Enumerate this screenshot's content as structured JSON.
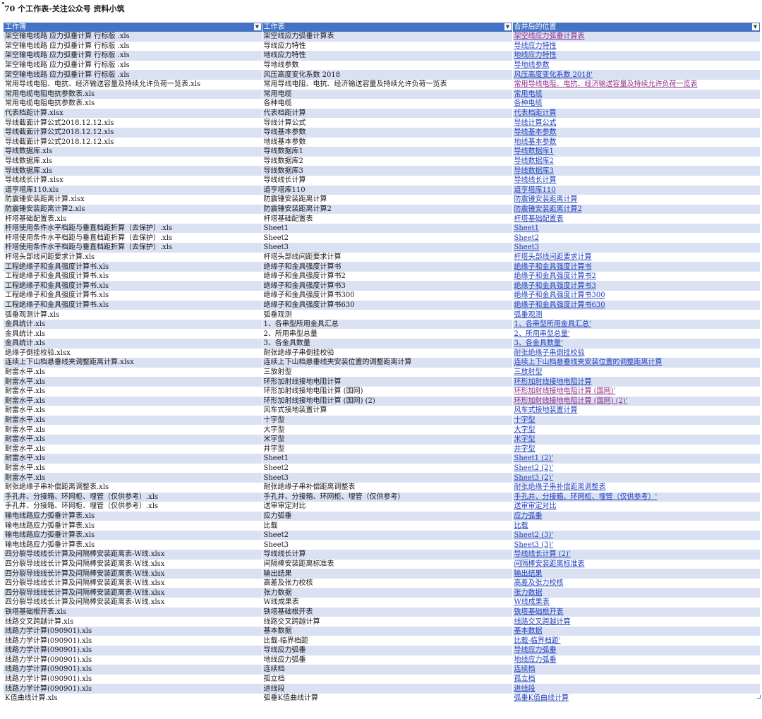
{
  "title": "70 个工作表-关注公众号 资料小筑",
  "headers": [
    "工作簿",
    "工作表",
    "合并后的位置"
  ],
  "filter_icon": "dropdown-arrow-icon",
  "colors": {
    "header": "#4472c4",
    "band": "#d9e1f2",
    "link": "#1f3fbf",
    "visited_link": "#8e2f8a"
  },
  "rows": [
    {
      "workbook": "架空输电线路 应力弧垂计算 行标版 .xls",
      "sheet": "架空线应力弧垂计算表",
      "link": "架空线应力弧垂计算表",
      "visited": true
    },
    {
      "workbook": "架空输电线路 应力弧垂计算 行标版 .xls",
      "sheet": "导线应力特性",
      "link": "导线应力特性",
      "visited": false
    },
    {
      "workbook": "架空输电线路 应力弧垂计算 行标版 .xls",
      "sheet": "地线应力特性",
      "link": "地线应力特性",
      "visited": false
    },
    {
      "workbook": "架空输电线路 应力弧垂计算 行标版 .xls",
      "sheet": "导地线参数",
      "link": "导地线参数",
      "visited": false
    },
    {
      "workbook": "架空输电线路 应力弧垂计算 行标版 .xls",
      "sheet": "风压高度变化系数 2018",
      "link": "风压高度变化系数 2018'",
      "visited": false
    },
    {
      "workbook": "常用导线电阻、电抗、经济输送容量及持续允许负荷一览表.xls",
      "sheet": "常用导线电阻、电抗、经济输送容量及持续允许负荷一览表",
      "link": "常用导线电阻、电抗、经济输送容量及持续允许负荷一览表",
      "visited": true
    },
    {
      "workbook": "常用电缆电阻电抗参数表.xls",
      "sheet": "常用电缆",
      "link": "常用电缆",
      "visited": false
    },
    {
      "workbook": "常用电缆电阻电抗参数表.xls",
      "sheet": "各种电缆",
      "link": "各种电缆",
      "visited": false
    },
    {
      "workbook": "代表档距计算.xlsx",
      "sheet": "代表档距计算",
      "link": "代表档距计算",
      "visited": false
    },
    {
      "workbook": "导线截面计算公式2018.12.12.xls",
      "sheet": "导线计算公式",
      "link": "导线计算公式",
      "visited": false
    },
    {
      "workbook": "导线截面计算公式2018.12.12.xls",
      "sheet": "导线基本参数",
      "link": "导线基本参数",
      "visited": false
    },
    {
      "workbook": "导线截面计算公式2018.12.12.xls",
      "sheet": "地线基本参数",
      "link": "地线基本参数",
      "visited": false
    },
    {
      "workbook": "导线数据库.xls",
      "sheet": "导线数据库1",
      "link": "导线数据库1",
      "visited": false
    },
    {
      "workbook": "导线数据库.xls",
      "sheet": "导线数据库2",
      "link": "导线数据库2",
      "visited": false
    },
    {
      "workbook": "导线数据库.xls",
      "sheet": "导线数据库3",
      "link": "导线数据库3",
      "visited": false
    },
    {
      "workbook": "导线线长计算.xlsx",
      "sheet": "导线线长计算",
      "link": "导线线长计算",
      "visited": false
    },
    {
      "workbook": "道亨塔库110.xls",
      "sheet": "道亨塔库110",
      "link": "道亨塔库110",
      "visited": false
    },
    {
      "workbook": "防震锤安装距离计算.xlsx",
      "sheet": "防震锤安装距离计算",
      "link": "防震锤安装距离计算",
      "visited": false
    },
    {
      "workbook": "防震锤安装距离计算2.xls",
      "sheet": "防震锤安装距离计算2",
      "link": "防震锤安装距离计算2",
      "visited": false
    },
    {
      "workbook": "杆塔基础配置表.xls",
      "sheet": "杆塔基础配置表",
      "link": "杆塔基础配置表",
      "visited": false
    },
    {
      "workbook": "杆塔使用条件水平档距与垂直档距折算（去保护）.xls",
      "sheet": "Sheet1",
      "link": "Sheet1",
      "visited": false
    },
    {
      "workbook": "杆塔使用条件水平档距与垂直档距折算（去保护）.xls",
      "sheet": "Sheet2",
      "link": "Sheet2",
      "visited": false
    },
    {
      "workbook": "杆塔使用条件水平档距与垂直档距折算（去保护）.xls",
      "sheet": "Sheet3",
      "link": "Sheet3",
      "visited": false
    },
    {
      "workbook": "杆塔头部线间距要求计算.xls",
      "sheet": "杆塔头部线间距要求计算",
      "link": "杆塔头部线间距要求计算",
      "visited": false
    },
    {
      "workbook": "工程绝缘子和金具强度计算书.xls",
      "sheet": "绝缘子和金具强度计算书",
      "link": "绝缘子和金具强度计算书",
      "visited": false
    },
    {
      "workbook": "工程绝缘子和金具强度计算书.xls",
      "sheet": "绝缘子和金具强度计算书2",
      "link": "绝缘子和金具强度计算书2",
      "visited": false
    },
    {
      "workbook": "工程绝缘子和金具强度计算书.xls",
      "sheet": "绝缘子和金具强度计算书3",
      "link": "绝缘子和金具强度计算书3",
      "visited": false
    },
    {
      "workbook": "工程绝缘子和金具强度计算书.xls",
      "sheet": "绝缘子和金具强度计算书300",
      "link": "绝缘子和金具强度计算书300",
      "visited": false
    },
    {
      "workbook": "工程绝缘子和金具强度计算书.xls",
      "sheet": "绝缘子和金具强度计算书630",
      "link": "绝缘子和金具强度计算书630",
      "visited": false
    },
    {
      "workbook": "弧垂观测计算.xls",
      "sheet": "弧垂观测",
      "link": "弧垂观测",
      "visited": false
    },
    {
      "workbook": "金具统计.xls",
      "sheet": "1、各串型所用金具汇总",
      "link": "1、各串型所用金具汇总'",
      "visited": false
    },
    {
      "workbook": "金具统计.xls",
      "sheet": "2、所用串型总量",
      "link": "2、所用串型总量'",
      "visited": false
    },
    {
      "workbook": "金具统计.xls",
      "sheet": "3、各金具数量",
      "link": "3、各金具数量'",
      "visited": false
    },
    {
      "workbook": "绝缘子倒挂校验.xlsx",
      "sheet": "耐张绝缘子串倒挂校验",
      "link": "耐张绝缘子串倒挂校验",
      "visited": false
    },
    {
      "workbook": "连续上下山档悬垂线夹调整距离计算.xlsx",
      "sheet": "连续上下山档悬垂线夹安装位置的调整距离计算",
      "link": "连续上下山档悬垂线夹安装位置的调整距离计算",
      "visited": false
    },
    {
      "workbook": "耐雷水平.xls",
      "sheet": "三放射型",
      "link": "三放射型",
      "visited": false
    },
    {
      "workbook": "耐雷水平.xls",
      "sheet": "环形加射线接地电阻计算",
      "link": "环形加射线接地电阻计算",
      "visited": false
    },
    {
      "workbook": "耐雷水平.xls",
      "sheet": "环形加射线接地电阻计算 (国网)",
      "link": "环形加射线接地电阻计算 (国网)'",
      "visited": true
    },
    {
      "workbook": "耐雷水平.xls",
      "sheet": "环形加射线接地电阻计算 (国网) (2)",
      "link": "环形加射线接地电阻计算 (国网) (2)'",
      "visited": true
    },
    {
      "workbook": "耐雷水平.xls",
      "sheet": "风车式接地装置计算",
      "link": "风车式接地装置计算",
      "visited": false
    },
    {
      "workbook": "耐雷水平.xls",
      "sheet": "十字型",
      "link": "十字型",
      "visited": false
    },
    {
      "workbook": "耐雷水平.xls",
      "sheet": "大字型",
      "link": "大字型",
      "visited": false
    },
    {
      "workbook": "耐雷水平.xls",
      "sheet": "米字型",
      "link": "米字型",
      "visited": false
    },
    {
      "workbook": "耐雷水平.xls",
      "sheet": "井字型",
      "link": "井字型",
      "visited": false
    },
    {
      "workbook": "耐雷水平.xls",
      "sheet": "Sheet1",
      "link": "Sheet1 (2)'",
      "visited": false
    },
    {
      "workbook": "耐雷水平.xls",
      "sheet": "Sheet2",
      "link": "Sheet2 (2)'",
      "visited": false
    },
    {
      "workbook": "耐雷水平.xls",
      "sheet": "Sheet3",
      "link": "Sheet3 (2)'",
      "visited": false
    },
    {
      "workbook": "耐张绝缘子串补偿距离调整表.xls",
      "sheet": "耐张绝缘子串补偿距离调整表",
      "link": "耐张绝缘子串补偿距离调整表",
      "visited": false
    },
    {
      "workbook": "手孔井、分接箱、环网柜、埋管（仅供参考）.xls",
      "sheet": "手孔井、分接箱、环网柜、埋管（仅供参考）",
      "link": "手孔井、分接箱、环网柜、埋管（仅供参考）'",
      "visited": false
    },
    {
      "workbook": "手孔井、分接箱、环网柜、埋管（仅供参考）.xls",
      "sheet": "送审审定对比",
      "link": "送审审定对比",
      "visited": false
    },
    {
      "workbook": "输电线路应力弧垂计算表.xls",
      "sheet": "应力弧垂",
      "link": "应力弧垂",
      "visited": false
    },
    {
      "workbook": "输电线路应力弧垂计算表.xls",
      "sheet": "比载",
      "link": "比载",
      "visited": false
    },
    {
      "workbook": "输电线路应力弧垂计算表.xls",
      "sheet": "Sheet2",
      "link": "Sheet2 (3)'",
      "visited": false
    },
    {
      "workbook": "输电线路应力弧垂计算表.xls",
      "sheet": "Sheet3",
      "link": "Sheet3 (3)'",
      "visited": false
    },
    {
      "workbook": "四分裂导线线长计算及间隔棒安装距离表-W线.xlsx",
      "sheet": "导线线长计算",
      "link": "导线线长计算 (2)'",
      "visited": false
    },
    {
      "workbook": "四分裂导线线长计算及间隔棒安装距离表-W线.xlsx",
      "sheet": "间隔棒安装距离标准表",
      "link": "间隔棒安装距离标准表",
      "visited": false
    },
    {
      "workbook": "四分裂导线线长计算及间隔棒安装距离表-W线.xlsx",
      "sheet": "输出结果",
      "link": "输出结果",
      "visited": false
    },
    {
      "workbook": "四分裂导线线长计算及间隔棒安装距离表-W线.xlsx",
      "sheet": "高差及张力校核",
      "link": "高差及张力校核",
      "visited": false
    },
    {
      "workbook": "四分裂导线线长计算及间隔棒安装距离表-W线.xlsx",
      "sheet": "张力数据",
      "link": "张力数据",
      "visited": false
    },
    {
      "workbook": "四分裂导线线长计算及间隔棒安装距离表-W线.xlsx",
      "sheet": "W线成果表",
      "link": "W线成果表",
      "visited": false
    },
    {
      "workbook": "铁塔基础根开表.xls",
      "sheet": "铁塔基础根开表",
      "link": "铁塔基础根开表",
      "visited": false
    },
    {
      "workbook": "线路交叉跨越计算.xls",
      "sheet": "线路交叉跨越计算",
      "link": "线路交叉跨越计算",
      "visited": false
    },
    {
      "workbook": "线路力学计算(090901).xls",
      "sheet": "基本数据",
      "link": "基本数据",
      "visited": false
    },
    {
      "workbook": "线路力学计算(090901).xls",
      "sheet": "比载-临界档距",
      "link": "比载-临界档距'",
      "visited": false
    },
    {
      "workbook": "线路力学计算(090901).xls",
      "sheet": "导线应力弧垂",
      "link": "导线应力弧垂",
      "visited": false
    },
    {
      "workbook": "线路力学计算(090901).xls",
      "sheet": "地线应力弧垂",
      "link": "地线应力弧垂",
      "visited": false
    },
    {
      "workbook": "线路力学计算(090901).xls",
      "sheet": "连续档",
      "link": "连续档",
      "visited": false
    },
    {
      "workbook": "线路力学计算(090901).xls",
      "sheet": "孤立档",
      "link": "孤立档",
      "visited": false
    },
    {
      "workbook": "线路力学计算(090901).xls",
      "sheet": "进线段",
      "link": "进线段",
      "visited": false
    },
    {
      "workbook": "K值曲线计算.xls",
      "sheet": "弧垂K值曲线计算",
      "link": "弧垂K值曲线计算",
      "visited": false
    }
  ]
}
